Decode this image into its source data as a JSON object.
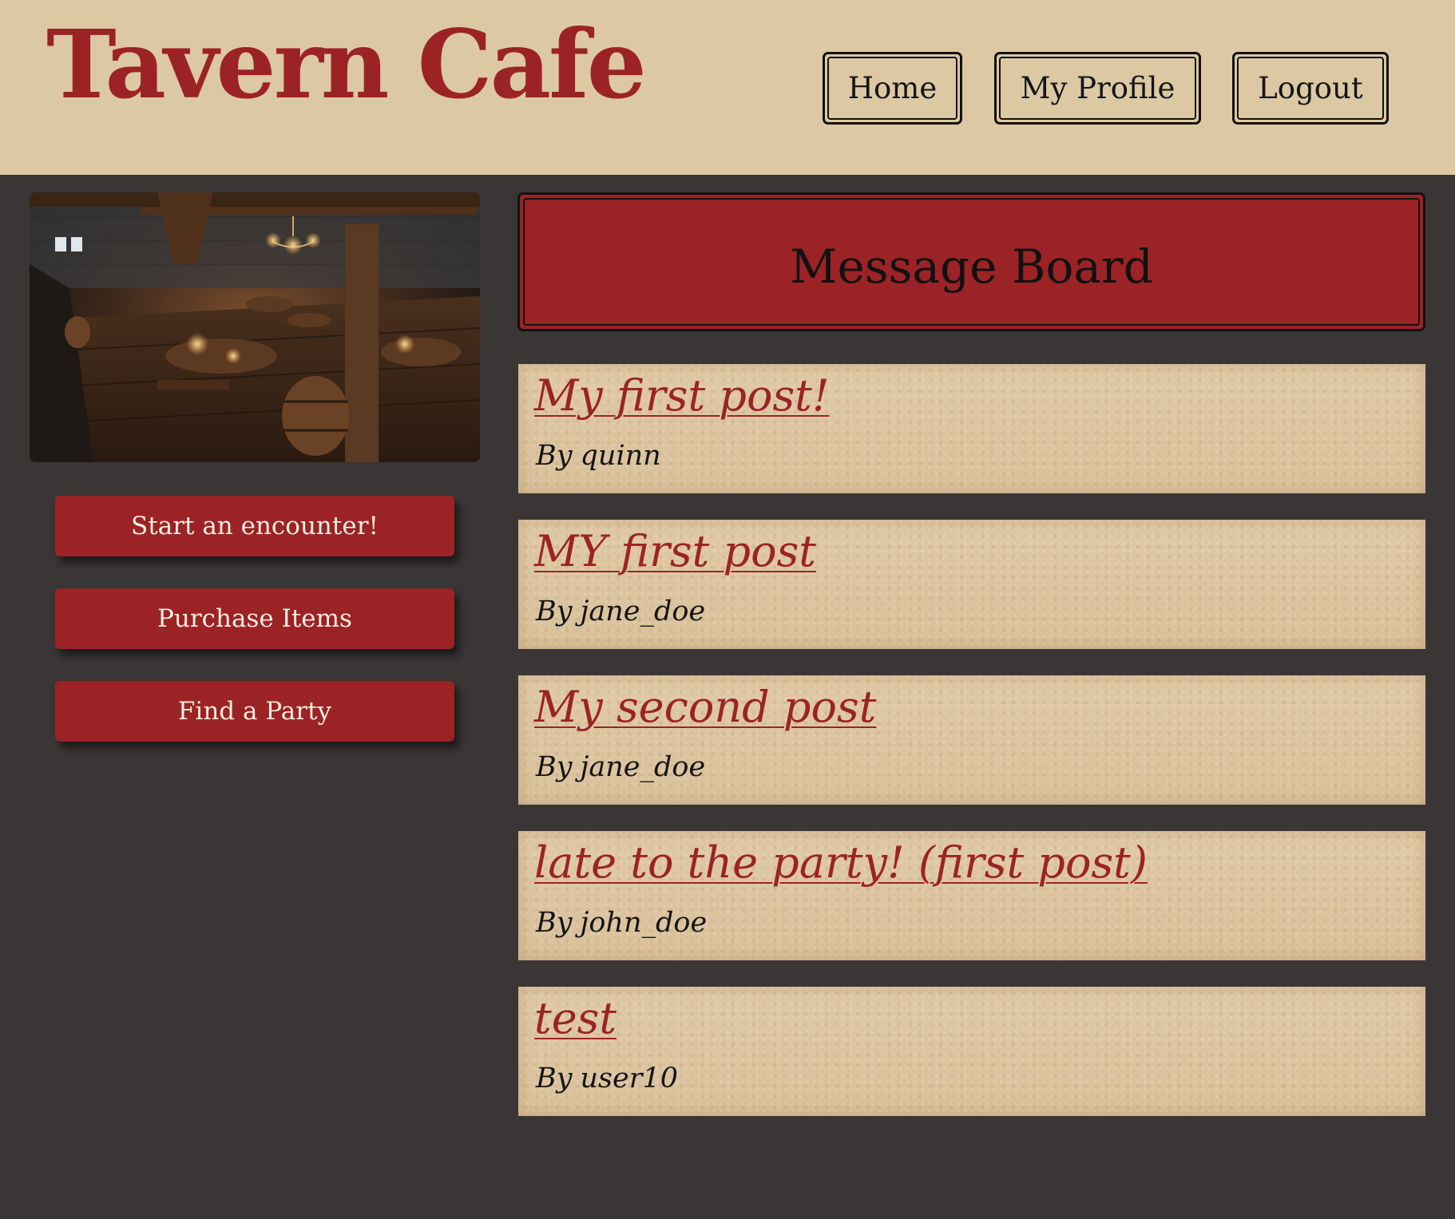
{
  "header": {
    "logo": "Tavern Cafe",
    "nav": {
      "home": "Home",
      "profile": "My Profile",
      "logout": "Logout"
    }
  },
  "sidebar": {
    "image": "tavern-interior-image",
    "buttons": {
      "encounter": "Start an encounter!",
      "purchase": "Purchase Items",
      "party": "Find a Party"
    }
  },
  "main": {
    "title": "Message Board",
    "by_prefix": "By",
    "posts": [
      {
        "title": "My first post!",
        "author": "quinn"
      },
      {
        "title": "MY first post",
        "author": "jane_doe"
      },
      {
        "title": "My second post",
        "author": "jane_doe"
      },
      {
        "title": "late to the party! (first post)",
        "author": "john_doe"
      },
      {
        "title": "test",
        "author": "user10"
      }
    ]
  },
  "colors": {
    "brand_red": "#9b2325",
    "header_bg": "#ddc8a4",
    "page_bg": "#3a3636",
    "parchment": "#dcc4a0"
  }
}
